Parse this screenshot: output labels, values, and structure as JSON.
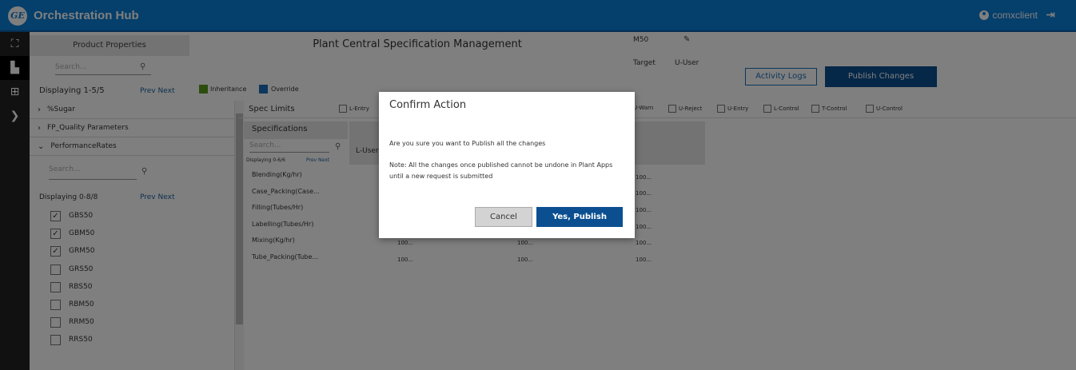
{
  "app": {
    "title": "Orchestration Hub",
    "logo": "GE",
    "user": "comxclient",
    "brand_color": "#0a7fd6"
  },
  "rail": {
    "items": [
      {
        "icon": "hierarchy-icon",
        "glyph": "⛶"
      },
      {
        "icon": "factory-icon",
        "glyph": "▙",
        "active": true
      },
      {
        "icon": "grid-icon",
        "glyph": "⊞"
      },
      {
        "icon": "expand-icon",
        "glyph": "❯"
      }
    ]
  },
  "header": {
    "tab_product": "Product Properties",
    "page_title": "Plant Central Specification Management",
    "search_placeholder": "Search...",
    "displaying": "Displaying 1-5/5",
    "prev": "Prev",
    "next": "Next",
    "legend_inheritance": "Inheritance",
    "legend_override": "Override",
    "legend_inheritance_color": "#5b9a1f",
    "legend_override_color": "#1a6fb8",
    "activity_logs": "Activity Logs",
    "publish_changes": "Publish Changes"
  },
  "tree": {
    "items": [
      {
        "label": "%Sugar",
        "expanded": false
      },
      {
        "label": "FP_Quality Parameters",
        "expanded": false
      },
      {
        "label": "PerformanceRates",
        "expanded": true
      }
    ],
    "perf": {
      "search_placeholder": "Search...",
      "displaying": "Displaying 0-8/8",
      "prev": "Prev",
      "next": "Next",
      "checkboxes": [
        {
          "label": "GBS50",
          "checked": true
        },
        {
          "label": "GBM50",
          "checked": true
        },
        {
          "label": "GRM50",
          "checked": true
        },
        {
          "label": "GRS50",
          "checked": false
        },
        {
          "label": "RBS50",
          "checked": false
        },
        {
          "label": "RBM50",
          "checked": false
        },
        {
          "label": "RRM50",
          "checked": false
        },
        {
          "label": "RRS50",
          "checked": false
        }
      ]
    }
  },
  "spec_limits": {
    "label": "Spec Limits",
    "options": [
      "L-Entry",
      "U-Warn",
      "U-Reject",
      "U-Entry",
      "L-Control",
      "T-Control",
      "U-Control"
    ]
  },
  "specs": {
    "header": "Specifications",
    "search_placeholder": "Search...",
    "displaying": "Displaying 0-6/6",
    "prev": "Prev",
    "next": "Next",
    "items": [
      "Blending(Kg/hr)",
      "Case_Packing(Case...",
      "Filling(Tubes/Hr)",
      "Labelling(Tubes/Hr)",
      "Mixing(Kg/hr)",
      "Tube_Packing(Tube..."
    ]
  },
  "grid": {
    "col_luser": "L-User",
    "col_group": "M50",
    "col_target": "Target",
    "col_uuser": "U-User",
    "target_values": [
      "100...",
      "100...",
      "100...",
      "100...",
      "100...",
      "100..."
    ],
    "extra_row_5": [
      "100...",
      "100..."
    ],
    "extra_row_6": [
      "100...",
      "100..."
    ]
  },
  "modal": {
    "title": "Confirm Action",
    "message": "Are you sure you want to Publish all the changes",
    "note": "Note: All the changes once published cannot be undone in Plant Apps until a new request is submitted",
    "cancel": "Cancel",
    "confirm": "Yes, Publish"
  }
}
